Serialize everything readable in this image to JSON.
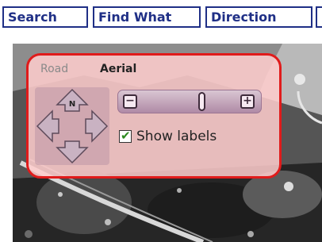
{
  "tabs": [
    {
      "label": "Search"
    },
    {
      "label": "Find What"
    },
    {
      "label": "Direction"
    },
    {
      "label": "["
    }
  ],
  "map_control": {
    "views": {
      "road": "Road",
      "aerial": "Aerial",
      "selected": "Aerial"
    },
    "pan": {
      "north_label": "N"
    },
    "zoom": {
      "out_label": "−",
      "in_label": "+",
      "level": 0.6
    },
    "show_labels": {
      "label": "Show labels",
      "checked": true,
      "check_glyph": "✔"
    }
  },
  "colors": {
    "tab_blue": "#1f2f86",
    "panel_border": "#e01b1b",
    "check_green": "#2c8a1f"
  }
}
